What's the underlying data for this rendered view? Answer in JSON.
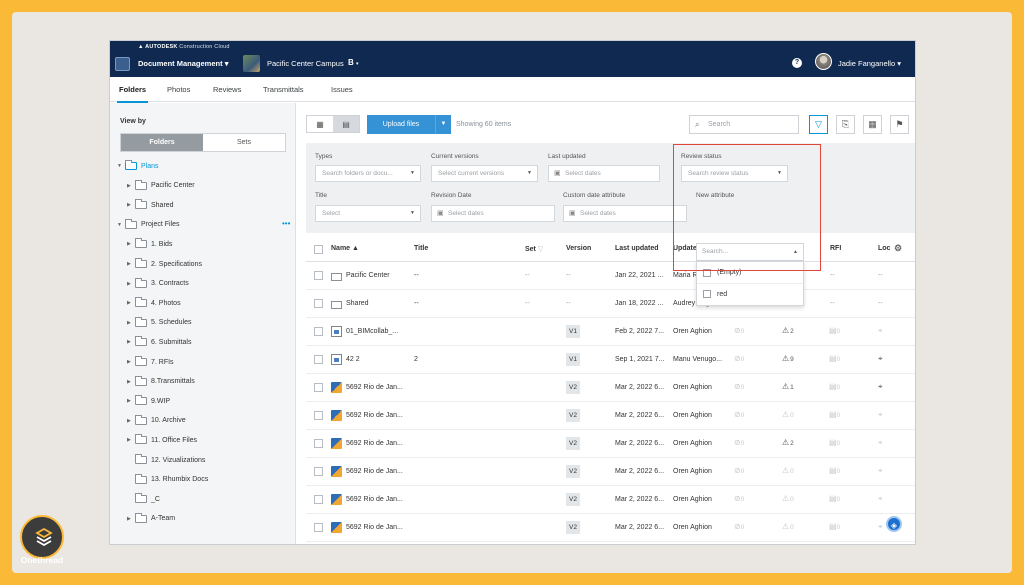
{
  "header": {
    "brand": "AUTODESK",
    "brand_suffix": "Construction Cloud",
    "module": "Document Management",
    "project": "Pacific Center Campus",
    "project_badge": "B",
    "user": "Jadie Fanganello",
    "help": "?"
  },
  "tabs": [
    {
      "label": "Folders",
      "active": true
    },
    {
      "label": "Photos"
    },
    {
      "label": "Reviews"
    },
    {
      "label": "Transmittals"
    },
    {
      "label": "Issues"
    }
  ],
  "sidebar": {
    "view_by": "View by",
    "seg": [
      "Folders",
      "Sets"
    ],
    "tree": [
      {
        "label": "Plans",
        "level": 0,
        "kind": "plans"
      },
      {
        "label": "Pacific Center",
        "level": 1
      },
      {
        "label": "Shared",
        "level": 1
      },
      {
        "label": "Project Files",
        "level": 0,
        "kind": "project"
      },
      {
        "label": "1. Bids",
        "level": 1
      },
      {
        "label": "2. Specifications",
        "level": 1
      },
      {
        "label": "3. Contracts",
        "level": 1
      },
      {
        "label": "4. Photos",
        "level": 1
      },
      {
        "label": "5. Schedules",
        "level": 1
      },
      {
        "label": "6. Submittals",
        "level": 1
      },
      {
        "label": "7. RFIs",
        "level": 1
      },
      {
        "label": "8.Transmittals",
        "level": 1
      },
      {
        "label": "9.WIP",
        "level": 1
      },
      {
        "label": "10. Archive",
        "level": 1
      },
      {
        "label": "11. Office Files",
        "level": 1
      },
      {
        "label": "12. Vizualizations",
        "level": 1
      },
      {
        "label": "13. Rhumbix Docs",
        "level": 1
      },
      {
        "label": "_C",
        "level": 1
      },
      {
        "label": "A-Team",
        "level": 1
      }
    ]
  },
  "toolbar": {
    "upload": "Upload files",
    "showing": "Showing 60 items",
    "search_placeholder": "Search"
  },
  "filters": {
    "types_label": "Types",
    "types_placeholder": "Search folders or docu...",
    "current_versions_label": "Current versions",
    "current_versions_placeholder": "Select current versions",
    "last_updated_label": "Last updated",
    "last_updated_placeholder": "Select dates",
    "review_status_label": "Review status",
    "review_status_placeholder": "Search review status",
    "title_label": "Title",
    "title_placeholder": "Select",
    "revision_date_label": "Revision Date",
    "revision_date_placeholder": "Select dates",
    "custom_date_label": "Custom date attribute",
    "custom_date_placeholder": "Select dates",
    "new_attr_label": "New attribute",
    "new_attr_placeholder": "Search...",
    "new_attr_options": [
      "(Empty)",
      "red"
    ]
  },
  "table": {
    "headers": {
      "name": "Name",
      "title": "Title",
      "set": "Set",
      "version": "Version",
      "last_updated": "Last updated",
      "updated_by": "Updated",
      "rfi": "RFI",
      "loc": "Loc"
    },
    "rows": [
      {
        "icon": "folder",
        "name": "Pacific Center",
        "title": "--",
        "set": "--",
        "version": "--",
        "date": "Jan 22, 2021 ...",
        "by": "Maria Risuen...",
        "c1": "--",
        "c2": "--",
        "rfi": "--",
        "loc": "--"
      },
      {
        "icon": "folder",
        "name": "Shared",
        "title": "--",
        "set": "--",
        "version": "--",
        "date": "Jan 18, 2022 ...",
        "by": "Audrey Boguc...",
        "c1": "--",
        "c2": "--",
        "rfi": "--",
        "loc": "--"
      },
      {
        "icon": "doc",
        "name": "01_BIMcollab_...",
        "title": "",
        "set": "",
        "version": "V1",
        "date": "Feb 2, 2022 7...",
        "by": "Oren Aghion",
        "c1": "0",
        "c2": "2",
        "c2dark": true,
        "rfi": "0",
        "locdark": false
      },
      {
        "icon": "doc",
        "name": "42 2",
        "title": "2",
        "set": "",
        "version": "V1",
        "date": "Sep 1, 2021 7...",
        "by": "Manu Venugo...",
        "c1": "0",
        "c2": "9",
        "c2dark": true,
        "rfi": "0",
        "locdark": true
      },
      {
        "icon": "rvt",
        "name": "5692 Rio de Jan...",
        "title": "",
        "set": "",
        "version": "V2",
        "date": "Mar 2, 2022 6...",
        "by": "Oren Aghion",
        "c1": "0",
        "c2": "1",
        "c2dark": true,
        "rfi": "0",
        "locdark": true
      },
      {
        "icon": "rvt",
        "name": "5692 Rio de Jan...",
        "title": "",
        "set": "",
        "version": "V2",
        "date": "Mar 2, 2022 6...",
        "by": "Oren Aghion",
        "c1": "0",
        "c2": "0",
        "c2dark": false,
        "rfi": "0",
        "locdark": false
      },
      {
        "icon": "rvt",
        "name": "5692 Rio de Jan...",
        "title": "",
        "set": "",
        "version": "V2",
        "date": "Mar 2, 2022 6...",
        "by": "Oren Aghion",
        "c1": "0",
        "c2": "2",
        "c2dark": true,
        "rfi": "0",
        "locdark": false
      },
      {
        "icon": "rvt",
        "name": "5692 Rio de Jan...",
        "title": "",
        "set": "",
        "version": "V2",
        "date": "Mar 2, 2022 6...",
        "by": "Oren Aghion",
        "c1": "0",
        "c2": "0",
        "c2dark": false,
        "rfi": "0",
        "locdark": false
      },
      {
        "icon": "rvt",
        "name": "5692 Rio de Jan...",
        "title": "",
        "set": "",
        "version": "V2",
        "date": "Mar 2, 2022 6...",
        "by": "Oren Aghion",
        "c1": "0",
        "c2": "0",
        "c2dark": false,
        "rfi": "0",
        "locdark": false
      },
      {
        "icon": "rvt",
        "name": "5692 Rio de Jan...",
        "title": "",
        "set": "",
        "version": "V2",
        "date": "Mar 2, 2022 6...",
        "by": "Oren Aghion",
        "c1": "0",
        "c2": "0",
        "c2dark": false,
        "rfi": "0",
        "locdark": false
      }
    ]
  },
  "watermark": {
    "text": "Onethread"
  },
  "colors": {
    "accent": "#0696d7",
    "topbar": "#0f2950",
    "highlight": "#e0473a",
    "frame": "#fbb938"
  }
}
